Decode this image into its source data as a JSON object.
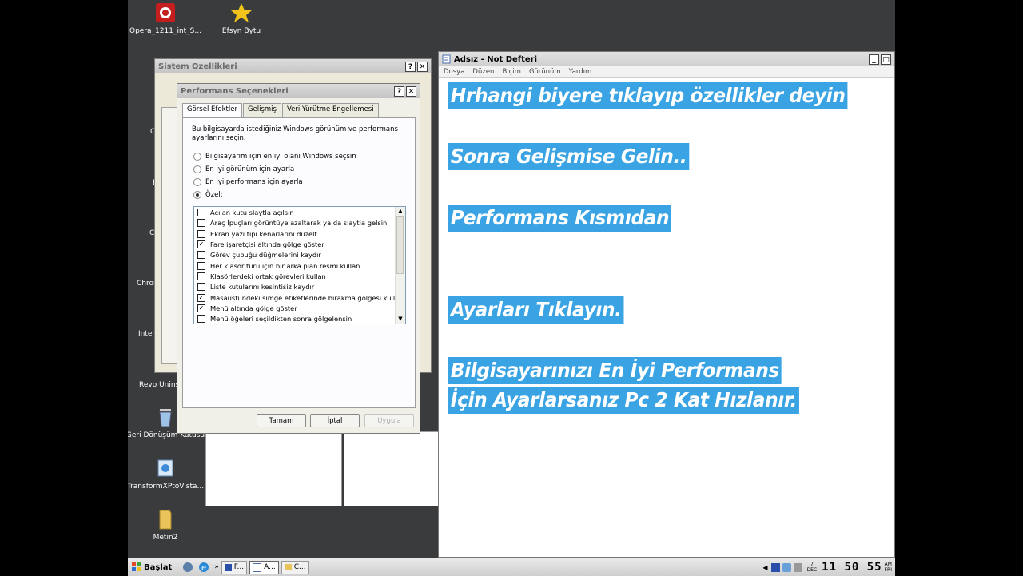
{
  "desktop": {
    "icons": [
      {
        "label": "Opera_1211_int_S..."
      },
      {
        "label": "Efsyn Bytu"
      },
      {
        "label": "Geri Dönüşüm Kutusu"
      },
      {
        "label": "TransformXPtoVista..."
      },
      {
        "label": "Metin2"
      }
    ],
    "peek_labels": [
      "C",
      "E",
      "C",
      "Chron",
      "Inter",
      "Revo Unins"
    ]
  },
  "sistem_ozellikleri": {
    "title": "Sistem Özellikleri",
    "help": "?",
    "close": "✕"
  },
  "performans": {
    "title": "Performans Seçenekleri",
    "help": "?",
    "close": "✕",
    "tabs": [
      "Görsel Efektler",
      "Gelişmiş",
      "Veri Yürütme Engellemesi"
    ],
    "description": "Bu bilgisayarda istediğiniz Windows görünüm ve performans ayarlarını seçin.",
    "options": [
      {
        "label": "Bilgisayarım için en iyi olanı Windows seçsin",
        "selected": false
      },
      {
        "label": "En iyi görünüm için ayarla",
        "selected": false
      },
      {
        "label": "En iyi performans için ayarla",
        "selected": false
      },
      {
        "label": "Özel:",
        "selected": true
      }
    ],
    "effects": [
      {
        "label": "Açılan kutu slaytla açılsın",
        "checked": false
      },
      {
        "label": "Araç İpuçları görüntüye azaltarak ya da slaytla gelsin",
        "checked": false
      },
      {
        "label": "Ekran yazı tipi kenarlarını düzelt",
        "checked": false
      },
      {
        "label": "Fare işaretçisi altında gölge göster",
        "checked": true
      },
      {
        "label": "Görev çubuğu düğmelerini kaydır",
        "checked": false
      },
      {
        "label": "Her klasör türü için bir arka plan resmi kullan",
        "checked": false
      },
      {
        "label": "Klasörlerdeki ortak görevleri kullan",
        "checked": false
      },
      {
        "label": "Liste kutularını kesintisiz kaydır",
        "checked": false
      },
      {
        "label": "Masaüstündeki simge etiketlerinde bırakma gölgesi kullan",
        "checked": true
      },
      {
        "label": "Menü altında gölge göster",
        "checked": true
      },
      {
        "label": "Menü öğeleri seçildikten sonra gölgelensin",
        "checked": false
      }
    ],
    "buttons": {
      "ok": "Tamam",
      "cancel": "İptal",
      "apply": "Uygula"
    }
  },
  "notepad": {
    "title": "Adsız - Not Defteri",
    "menu": [
      "Dosya",
      "Düzen",
      "Biçim",
      "Görünüm",
      "Yardım"
    ],
    "lines": [
      "Hrhangi biyere tıklayıp özellikler deyin",
      "Sonra Gelişmise Gelin..",
      "Performans Kısmıdan",
      "Ayarları Tıklayın.",
      "Bilgisayarınızı En İyi Performans",
      "İçin Ayarlarsanız  Pc 2 Kat Hızlanır."
    ],
    "highlight_color": "#3aa3e4"
  },
  "taskbar": {
    "start_label": "Başlat",
    "items": [
      "F...",
      "A...",
      "C..."
    ],
    "date_day": "7",
    "date_month": "DEC",
    "clock": "11 50 55",
    "ampm": "AM",
    "weekday": "FRI"
  }
}
